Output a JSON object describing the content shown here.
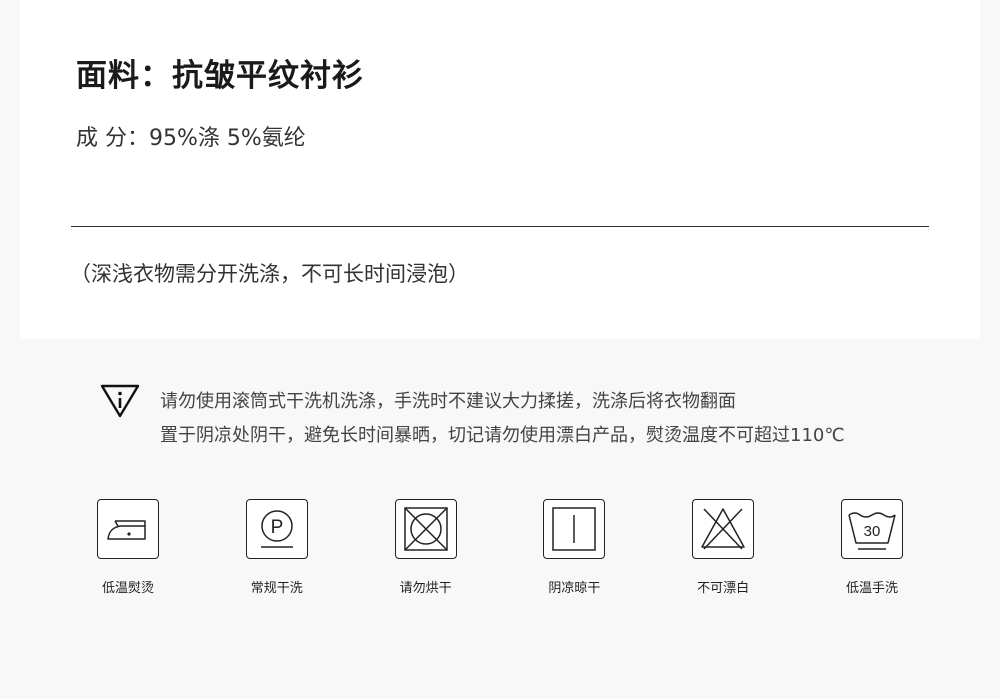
{
  "fabric": {
    "title": "面料：抗皱平纹衬衫",
    "composition": "成   分：95%涤 5%氨纶",
    "note": "（深浅衣物需分开洗涤，不可长时间浸泡）"
  },
  "warning": {
    "icon": "warning-triangle-icon",
    "line1": "请勿使用滚筒式干洗机洗涤，手洗时不建议大力揉搓，洗涤后将衣物翻面",
    "line2": "置于阴凉处阴干，避免长时间暴晒，切记请勿使用漂白产品，熨烫温度不可超过110℃"
  },
  "care": [
    {
      "icon": "iron-low-icon",
      "label": "低温熨烫"
    },
    {
      "icon": "dry-clean-p-icon",
      "label": "常规干洗"
    },
    {
      "icon": "no-tumble-dry-icon",
      "label": "请勿烘干"
    },
    {
      "icon": "shade-dry-icon",
      "label": "阴凉晾干"
    },
    {
      "icon": "no-bleach-icon",
      "label": "不可漂白"
    },
    {
      "icon": "hand-wash-30-icon",
      "label": "低温手洗",
      "temp": "30"
    }
  ]
}
